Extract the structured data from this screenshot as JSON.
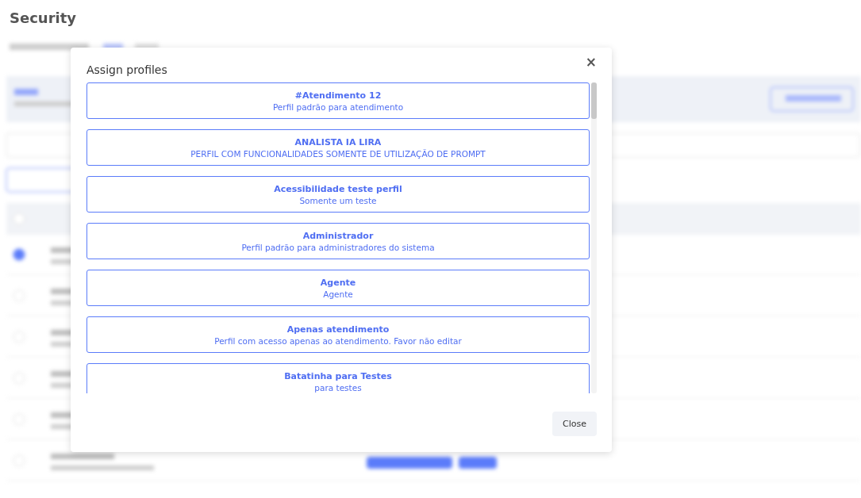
{
  "page": {
    "title": "Security"
  },
  "dialog": {
    "title": "Assign profiles",
    "close_icon": "×",
    "profiles": [
      {
        "name": "#Atendimento 12",
        "description": "Perfil padrão para atendimento"
      },
      {
        "name": "ANALISTA IA LIRA",
        "description": "PERFIL COM FUNCIONALIDADES SOMENTE DE UTILIZAÇÃO DE PROMPT"
      },
      {
        "name": "Acessibilidade teste perfil",
        "description": "Somente um teste"
      },
      {
        "name": "Administrador",
        "description": "Perfil padrão para administradores do sistema"
      },
      {
        "name": "Agente",
        "description": "Agente"
      },
      {
        "name": "Apenas atendimento",
        "description": "Perfil com acesso apenas ao atendimento. Favor não editar"
      },
      {
        "name": "Batatinha para Testes",
        "description": "para testes"
      }
    ],
    "close_button": "Close"
  }
}
